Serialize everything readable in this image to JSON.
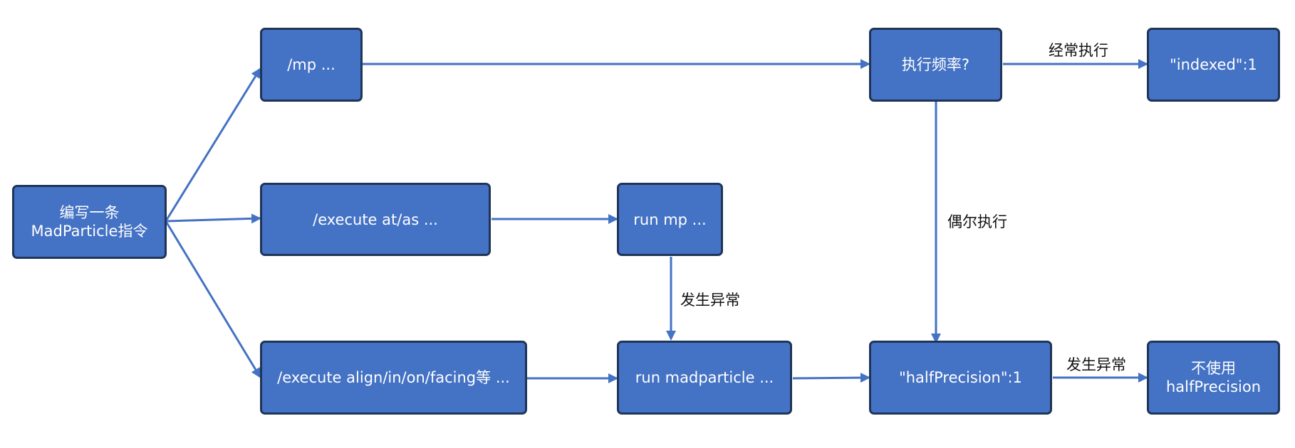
{
  "colors": {
    "node_fill": "#4472c4",
    "node_border": "#1f3557",
    "node_text": "#ffffff",
    "edge": "#4472c4",
    "label_text": "#111111"
  },
  "nodes": {
    "start": "编写一条\nMadParticle指令",
    "mp": "/mp ...",
    "exec_at": "/execute at/as ...",
    "exec_align": "/execute align/in/on/facing等 ...",
    "run_mp": "run mp ...",
    "run_madparticle": "run madparticle ...",
    "freq": "执行频率?",
    "indexed": "\"indexed\":1",
    "half_precision": "\"halfPrecision\":1",
    "no_half": "不使用\nhalfPrecision"
  },
  "edge_labels": {
    "often": "经常执行",
    "occasionally": "偶尔执行",
    "exception_1": "发生异常",
    "exception_2": "发生异常"
  }
}
